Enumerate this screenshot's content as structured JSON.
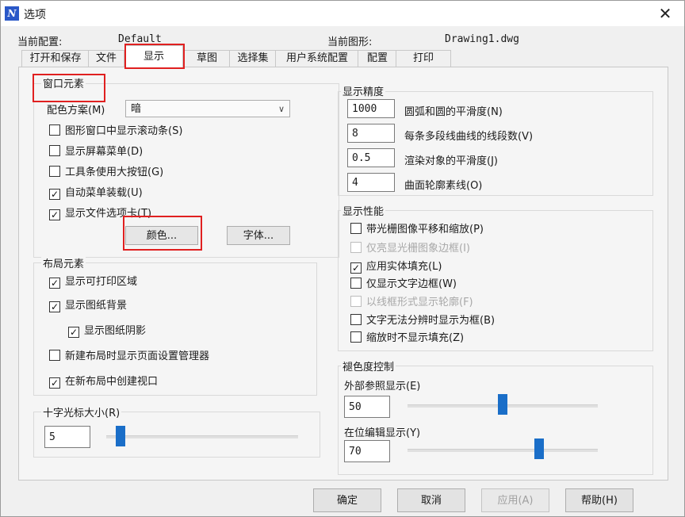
{
  "window": {
    "title": "选项",
    "close_glyph": "✕"
  },
  "header": {
    "current_profile_label": "当前配置:",
    "current_profile_value": "Default",
    "current_drawing_label": "当前图形:",
    "current_drawing_value": "Drawing1.dwg"
  },
  "tabs": [
    {
      "label": "打开和保存"
    },
    {
      "label": "文件"
    },
    {
      "label": "显示",
      "active": true
    },
    {
      "label": "草图"
    },
    {
      "label": "选择集"
    },
    {
      "label": "用户系统配置"
    },
    {
      "label": "配置"
    },
    {
      "label": "打印"
    }
  ],
  "window_elements": {
    "title": "窗口元素",
    "color_scheme_label": "配色方案(M)",
    "color_scheme_value": "暗",
    "checkboxes": [
      {
        "label": "图形窗口中显示滚动条(S)",
        "checked": false
      },
      {
        "label": "显示屏幕菜单(D)",
        "checked": false
      },
      {
        "label": "工具条使用大按钮(G)",
        "checked": false
      },
      {
        "label": "自动菜单装载(U)",
        "checked": true
      },
      {
        "label": "显示文件选项卡(T)",
        "checked": true
      }
    ],
    "colors_button": "颜色...",
    "fonts_button": "字体..."
  },
  "layout_elements": {
    "title": "布局元素",
    "checkboxes": [
      {
        "label": "显示可打印区域",
        "checked": true
      },
      {
        "label": "显示图纸背景",
        "checked": true
      },
      {
        "label": "显示图纸阴影",
        "checked": true
      },
      {
        "label": "新建布局时显示页面设置管理器",
        "checked": false
      },
      {
        "label": "在新布局中创建视口",
        "checked": true
      }
    ]
  },
  "crosshair": {
    "title": "十字光标大小(R)",
    "value": "5",
    "slider_fraction": 0.05
  },
  "display_resolution": {
    "title": "显示精度",
    "rows": [
      {
        "value": "1000",
        "label": "圆弧和圆的平滑度(N)"
      },
      {
        "value": "8",
        "label": "每条多段线曲线的线段数(V)"
      },
      {
        "value": "0.5",
        "label": "渲染对象的平滑度(J)"
      },
      {
        "value": "4",
        "label": "曲面轮廓素线(O)"
      }
    ]
  },
  "display_performance": {
    "title": "显示性能",
    "checkboxes": [
      {
        "label": "带光栅图像平移和缩放(P)",
        "checked": false,
        "disabled": false
      },
      {
        "label": "仅亮显光栅图象边框(I)",
        "checked": false,
        "disabled": true
      },
      {
        "label": "应用实体填充(L)",
        "checked": true,
        "disabled": false
      },
      {
        "label": "仅显示文字边框(W)",
        "checked": false,
        "disabled": false
      },
      {
        "label": "以线框形式显示轮廓(F)",
        "checked": false,
        "disabled": true
      },
      {
        "label": "文字无法分辨时显示为框(B)",
        "checked": false,
        "disabled": false
      },
      {
        "label": "缩放时不显示填充(Z)",
        "checked": false,
        "disabled": false
      }
    ]
  },
  "fade_control": {
    "title": "褪色度控制",
    "xref_label": "外部参照显示(E)",
    "xref_value": "50",
    "xref_slider_fraction": 0.5,
    "inplace_label": "在位编辑显示(Y)",
    "inplace_value": "70",
    "inplace_slider_fraction": 0.7
  },
  "footer": {
    "ok": "确定",
    "cancel": "取消",
    "apply": "应用(A)",
    "help": "帮助(H)"
  },
  "check_glyph": "✓"
}
